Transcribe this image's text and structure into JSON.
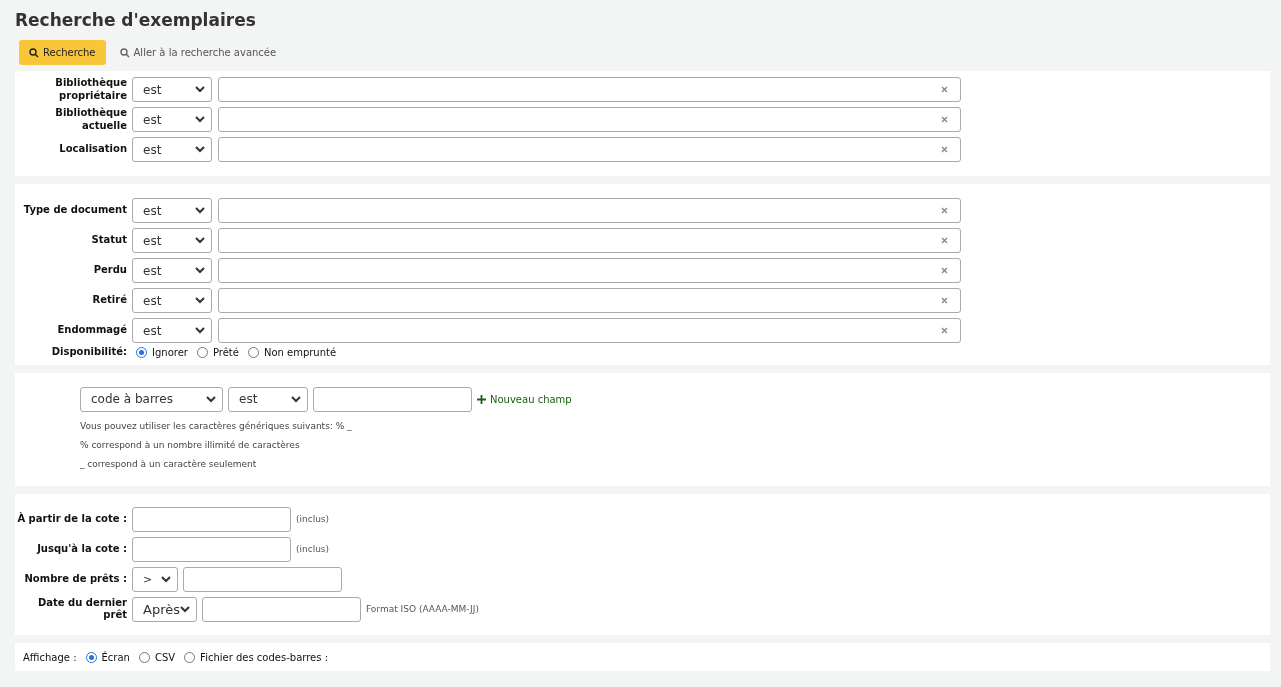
{
  "title": "Recherche d'exemplaires",
  "toolbar": {
    "search_button": "Recherche",
    "advanced_link": "Aller à la recherche avancée"
  },
  "location_filters": [
    {
      "label": "Bibliothèque propriétaire",
      "operator": "est"
    },
    {
      "label": "Bibliothèque actuelle",
      "operator": "est"
    },
    {
      "label": "Localisation",
      "operator": "est"
    }
  ],
  "status_filters": [
    {
      "label": "Type de document",
      "operator": "est"
    },
    {
      "label": "Statut",
      "operator": "est"
    },
    {
      "label": "Perdu",
      "operator": "est"
    },
    {
      "label": "Retiré",
      "operator": "est"
    },
    {
      "label": "Endommagé",
      "operator": "est"
    }
  ],
  "availability": {
    "label": "Disponibilité:",
    "options": [
      {
        "label": "Ignorer",
        "selected": true
      },
      {
        "label": "Prêté",
        "selected": false
      },
      {
        "label": "Non emprunté",
        "selected": false
      }
    ]
  },
  "field_search": {
    "field": "code à barres",
    "operator": "est",
    "add_link": "Nouveau champ",
    "hints": [
      "Vous pouvez utiliser les caractères génériques suivants: % _",
      "% correspond à un nombre illimité de caractères",
      "_ correspond à un caractère seulement"
    ]
  },
  "range_filters": [
    {
      "kind": "text",
      "label": "À partir de la cote :",
      "note": "(inclus)"
    },
    {
      "kind": "text",
      "label": "Jusqu'à la cote :",
      "note": "(inclus)"
    },
    {
      "kind": "compare",
      "label": "Nombre de prêts :",
      "operator": ">"
    },
    {
      "kind": "date",
      "label": "Date du dernier prêt",
      "operator": "Après",
      "note": "Format ISO (AAAA-MM-JJ)"
    }
  ],
  "display": {
    "label": "Affichage :",
    "options": [
      {
        "label": "Écran",
        "selected": true
      },
      {
        "label": "CSV",
        "selected": false
      },
      {
        "label": "Fichier des codes-barres :",
        "selected": false
      }
    ]
  }
}
